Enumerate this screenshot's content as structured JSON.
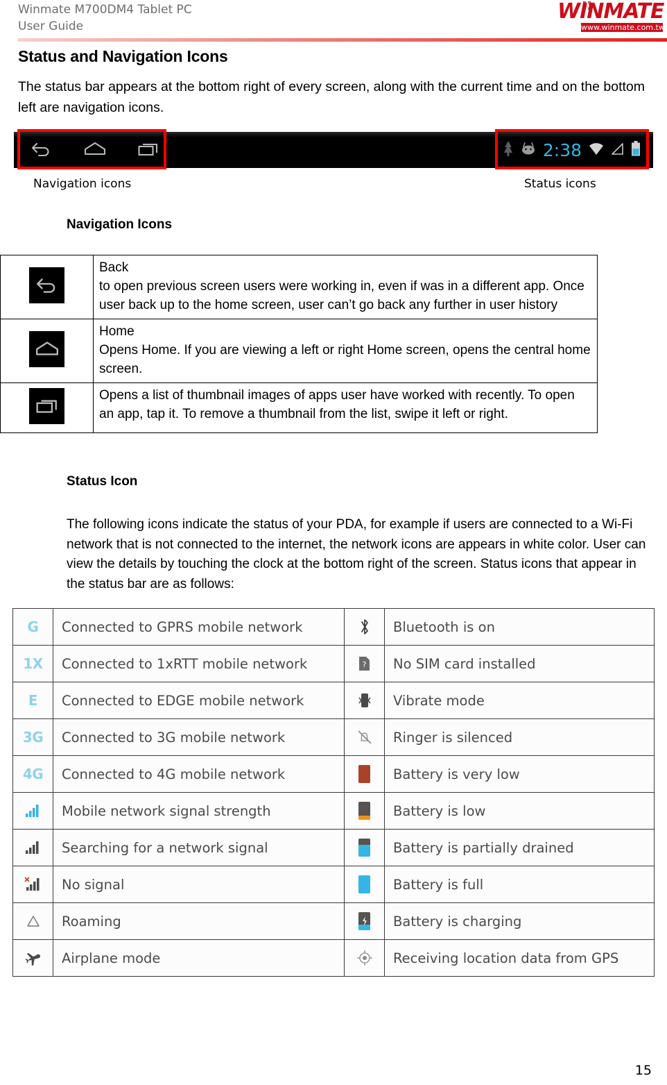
{
  "header": {
    "doc_title_line1": "Winmate M700DM4 Tablet PC",
    "doc_title_line2": "User Guide",
    "logo_wordmark": "WINMATE",
    "logo_url": "www.winmate.com.tw"
  },
  "section": {
    "h1": "Status and Navigation Icons",
    "intro": "The status bar appears at the bottom right of every screen, along with the current time and on the bottom left are navigation icons.",
    "nav_icons_heading": "Navigation Icons",
    "status_icon_heading": "Status Icon",
    "status_para": "The following icons indicate the status of your PDA, for example if users are connected to a Wi-Fi network that is not connected to the internet, the network icons are appears in white color. User can view the details by touching the clock at the bottom right of the screen. Status icons that appear in the status bar are as follows:"
  },
  "figure": {
    "caption_left": "Navigation icons",
    "caption_right": "Status icons",
    "clock": "2:38",
    "highlight_color": "#ff0000",
    "bar_background": "#000000",
    "clock_color": "#33b5e5",
    "nav_icons": [
      "back-icon",
      "home-icon",
      "recents-icon"
    ],
    "status_icons": [
      "tree-icon",
      "android-face-icon",
      "clock-text",
      "wifi-icon",
      "signal-icon",
      "battery-icon"
    ]
  },
  "nav_table": {
    "rows": [
      {
        "icon": "back-icon",
        "title": "Back",
        "desc": "to open previous screen users were working in, even if was in a different app. Once user back up to the home screen, user can’t go back any further in user history"
      },
      {
        "icon": "home-icon",
        "title": "Home",
        "desc": "Opens Home. If you are viewing a left or right Home screen, opens the central home screen."
      },
      {
        "icon": "recents-icon",
        "title": "",
        "desc": "Opens a list of thumbnail images of apps user have worked with recently. To open an app, tap it. To remove a thumbnail from the list, swipe it left or right."
      }
    ]
  },
  "status_table": {
    "rows": [
      {
        "left_icon": "gprs-network-icon",
        "left_icon_text": "G",
        "left_text": "Connected to GPRS mobile network",
        "right_icon": "bluetooth-icon",
        "right_text": "Bluetooth is on"
      },
      {
        "left_icon": "1xrtt-network-icon",
        "left_icon_text": "1X",
        "left_text": "Connected to 1xRTT mobile network",
        "right_icon": "no-sim-card-icon",
        "right_text": "No SIM card installed"
      },
      {
        "left_icon": "edge-network-icon",
        "left_icon_text": "E",
        "left_text": "Connected to EDGE mobile network",
        "right_icon": "vibrate-icon",
        "right_text": "Vibrate mode"
      },
      {
        "left_icon": "3g-network-icon",
        "left_icon_text": "3G",
        "left_text": "Connected to 3G mobile network",
        "right_icon": "ringer-silenced-icon",
        "right_text": "Ringer is silenced"
      },
      {
        "left_icon": "4g-network-icon",
        "left_icon_text": "4G",
        "left_text": "Connected to 4G mobile network",
        "right_icon": "battery-very-low-icon",
        "right_text": "Battery is very low"
      },
      {
        "left_icon": "signal-strength-icon",
        "left_icon_text": "",
        "left_text": "Mobile network signal strength",
        "right_icon": "battery-low-icon",
        "right_text": "Battery is low"
      },
      {
        "left_icon": "searching-signal-icon",
        "left_icon_text": "",
        "left_text": "Searching for a network signal",
        "right_icon": "battery-partially-drained-icon",
        "right_text": "Battery is partially drained"
      },
      {
        "left_icon": "no-signal-icon",
        "left_icon_text": "",
        "left_text": "No signal",
        "right_icon": "battery-full-icon",
        "right_text": "Battery is full"
      },
      {
        "left_icon": "roaming-icon",
        "left_icon_text": "",
        "left_text": "Roaming",
        "right_icon": "battery-charging-icon",
        "right_text": "Battery is charging"
      },
      {
        "left_icon": "airplane-mode-icon",
        "left_icon_text": "",
        "left_text": "Airplane mode",
        "right_icon": "gps-icon",
        "right_text": "Receiving location data from GPS"
      }
    ]
  },
  "footer": {
    "page_number": "15"
  },
  "colors": {
    "brand_red": "#cc0e1b",
    "highlight_red": "#ff0000",
    "network_blue": "#8fd3e8",
    "clock_blue": "#33b5e5",
    "battery_red": "#a8432a",
    "battery_orange": "#f0921e",
    "battery_cyan": "#33b5e5",
    "battery_dark": "#57534e"
  }
}
